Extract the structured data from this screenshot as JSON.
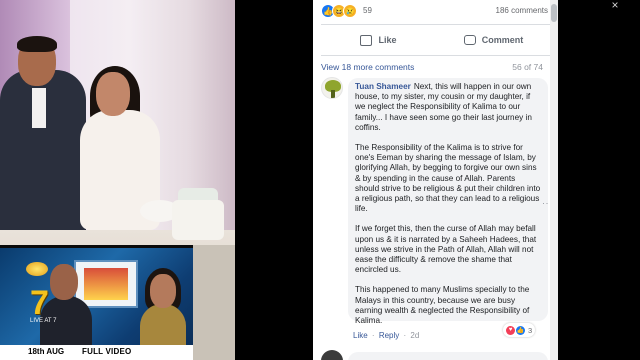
{
  "tv": {
    "channel_number": "7",
    "live_label": "LIVE AT 7",
    "date": "18th AUG",
    "banner": "FULL VIDEO"
  },
  "post": {
    "reaction_count": "59",
    "comments_count": "186 comments",
    "like_label": "Like",
    "comment_label": "Comment",
    "view_more": "View 18 more comments",
    "page_position": "56 of 74"
  },
  "comment": {
    "author": "Tuan Shameer",
    "paragraphs": [
      "Next, this will happen in our own house, to my sister, my cousin or my daughter, if we neglect the Responsibility of Kalima to our family... I have seen some go their last journey in coffins.",
      "The Responsibility of the Kalima is to strive for one's Eeman by sharing the message of Islam, by glorifying Allah, by begging to forgive our own sins & by spending in the cause of Allah. Parents should strive to be religious & put their children into a religious path, so that they can lead to a religious life.",
      "If we forget this, then the curse of Allah may befall upon us & it is narrated by a Saheeh Hadees, that unless we strive in the Path of Allah, Allah will not ease the difficulty & remove the shame that encircled us.",
      "This happened to many Muslims specially to the Malays in this country, because we are busy earning wealth & neglected the Responsibility of Kalima."
    ],
    "reaction_count": "3",
    "like_action": "Like",
    "reply_action": "Reply",
    "separator": "·",
    "time": "2d"
  },
  "colors": {
    "facebook_blue": "#385898",
    "like_blue": "#1877f2",
    "bubble_bg": "#f2f3f5"
  },
  "icons": {
    "close": "×",
    "more_options": "···"
  }
}
